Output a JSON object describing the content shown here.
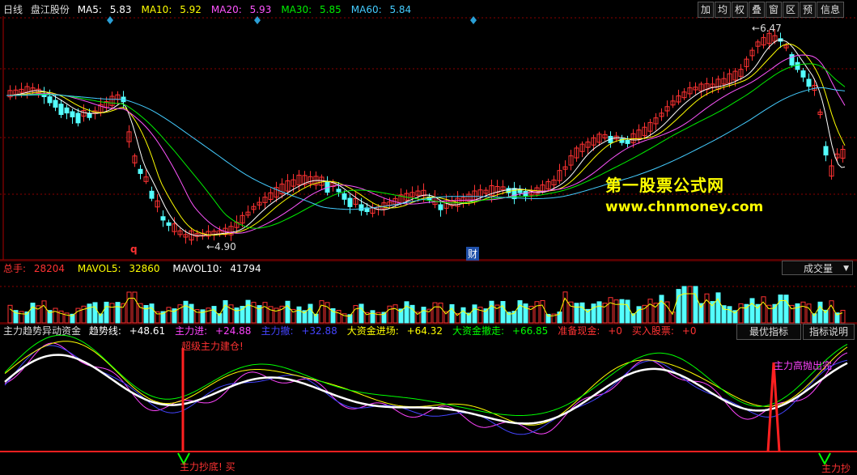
{
  "price_panel": {
    "period": "日线",
    "stock_name": "盘江股份",
    "ma": [
      {
        "label": "MA5:",
        "value": "5.83",
        "color": "#ffffff"
      },
      {
        "label": "MA10:",
        "value": "5.92",
        "color": "#ffff00"
      },
      {
        "label": "MA20:",
        "value": "5.93",
        "color": "#ff55ff"
      },
      {
        "label": "MA30:",
        "value": "5.85",
        "color": "#00ee00"
      },
      {
        "label": "MA60:",
        "value": "5.84",
        "color": "#44ccff"
      }
    ],
    "high_label": "6.47",
    "low_label": "4.90",
    "marker_q": "q",
    "marker_cai": "财",
    "toolbar": [
      "加",
      "均",
      "权",
      "叠",
      "窗",
      "区",
      "预",
      "信息"
    ],
    "watermark_cn": "第一股票公式网",
    "watermark_url": "www.chnmoney.com"
  },
  "volume_panel": {
    "total_label": "总手:",
    "total_value": "28204",
    "mavol5_label": "MAVOL5:",
    "mavol5_value": "32860",
    "mavol10_label": "MAVOL10:",
    "mavol10_value": "41794",
    "selector": "成交量"
  },
  "indicator_panel": {
    "name": "主力趋势异动资金",
    "items": [
      {
        "label": "趋势线:",
        "value": "+48.61",
        "color": "#ffffff"
      },
      {
        "label": "主力进:",
        "value": "+24.88",
        "color": "#ff44ff"
      },
      {
        "label": "主力撤:",
        "value": "+32.88",
        "color": "#4444ff"
      },
      {
        "label": "大资金进场:",
        "value": "+64.32",
        "color": "#ffff00"
      },
      {
        "label": "大资金撤走:",
        "value": "+66.85",
        "color": "#00ff00"
      },
      {
        "label": "准备现金:",
        "value": "+0",
        "color": "#ff3333"
      },
      {
        "label": "买入股票:",
        "value": "+0",
        "color": "#ff3333"
      }
    ],
    "btn_best": "最优指标",
    "btn_explain": "指标说明",
    "ann_build": "超级主力建仓!",
    "ann_bottom": "主力抄底! 买",
    "ann_exit": "主力高抛出完",
    "ann_bottom2": "主力抄"
  },
  "colors": {
    "up": "#ff3232",
    "down": "#54ffff",
    "bg": "#000000",
    "grid": "#8b0000"
  }
}
